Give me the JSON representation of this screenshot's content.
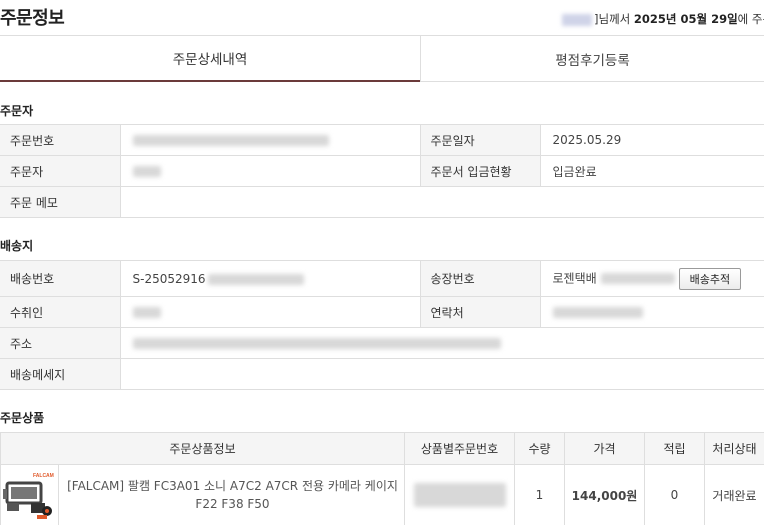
{
  "header": {
    "title": "주문정보",
    "greeting_suffix": "]님께서",
    "order_date_text": "2025년 05월 29일",
    "greeting_tail": "에 주문하"
  },
  "tabs": [
    {
      "label": "주문상세내역",
      "active": true
    },
    {
      "label": "평점후기등록",
      "active": false
    }
  ],
  "orderer": {
    "section_title": "주문자",
    "labels": {
      "order_number": "주문번호",
      "order_date": "주문일자",
      "orderer": "주문자",
      "deposit_status": "주문서 입금현황",
      "memo": "주문 메모"
    },
    "values": {
      "order_date": "2025.05.29",
      "deposit_status": "입금완료",
      "memo": ""
    }
  },
  "shipping": {
    "section_title": "배송지",
    "labels": {
      "shipping_number": "배송번호",
      "invoice_number": "송장번호",
      "recipient": "수취인",
      "contact": "연락처",
      "address": "주소",
      "message": "배송메세지"
    },
    "values": {
      "shipping_number_prefix": "S-25052916",
      "courier": "로젠택배",
      "message": ""
    },
    "track_button": "배송추적"
  },
  "products": {
    "section_title": "주문상품",
    "columns": [
      "주문상품정보",
      "상품별주문번호",
      "수량",
      "가격",
      "적립",
      "처리상태"
    ],
    "items": [
      {
        "name": "[FALCAM] 팔캠 FC3A01 소니 A7C2 A7CR 전용 카메라 케이지 F22 F38 F50",
        "thumb_brand": "FALCAM",
        "quantity": "1",
        "price": "144,000원",
        "points": "0",
        "status": "거래완료"
      }
    ]
  },
  "colors": {
    "active_tab_border": "#6b3a3a",
    "label_bg": "#f5f5f5",
    "border": "#dedede",
    "brand_logo": "#e05a2b"
  },
  "icons": {
    "thumb": "camera-cage-product-image"
  }
}
